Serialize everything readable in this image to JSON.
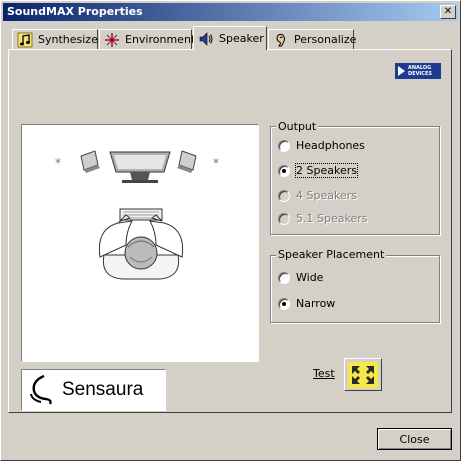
{
  "window": {
    "title": "SoundMAX Properties",
    "close_glyph": "✕"
  },
  "tabs": [
    {
      "label": "Synthesizer",
      "icon": "music-note-icon",
      "active": false
    },
    {
      "label": "Environment",
      "icon": "environment-icon",
      "active": false
    },
    {
      "label": "Speaker",
      "icon": "speaker-icon",
      "active": true
    },
    {
      "label": "Personalize",
      "icon": "ear-icon",
      "active": false
    }
  ],
  "brand": {
    "analog_devices": "ANALOG\nDEVICES",
    "sensaura": "Sensaura",
    "accent": "#1d3c91"
  },
  "output_group": {
    "title": "Output",
    "options": [
      {
        "label": "Headphones",
        "selected": false,
        "disabled": false
      },
      {
        "label": "2 Speakers",
        "selected": true,
        "disabled": false
      },
      {
        "label": "4 Speakers",
        "selected": false,
        "disabled": true
      },
      {
        "label": "5.1 Speakers",
        "selected": false,
        "disabled": true
      }
    ]
  },
  "placement_group": {
    "title": "Speaker Placement",
    "options": [
      {
        "label": "Wide",
        "selected": false,
        "disabled": false
      },
      {
        "label": "Narrow",
        "selected": true,
        "disabled": false
      }
    ]
  },
  "test": {
    "label": "Test",
    "icon": "test-arrows-icon"
  },
  "footer": {
    "close_label": "Close"
  }
}
